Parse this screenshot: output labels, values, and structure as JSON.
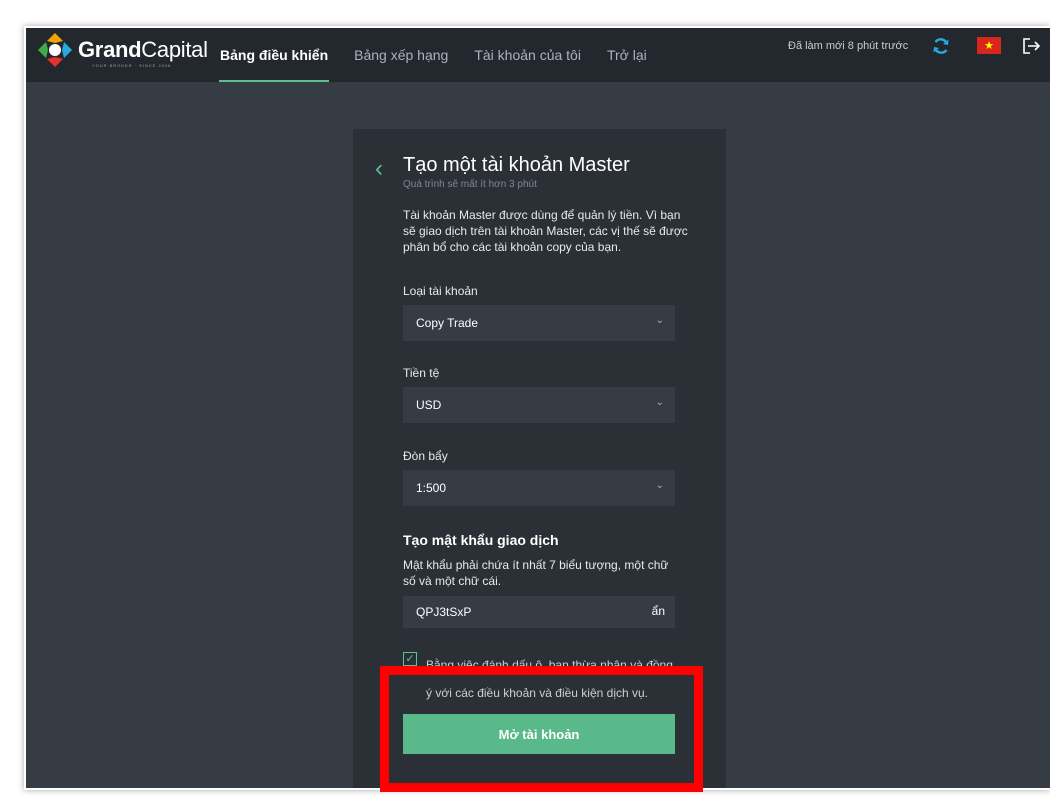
{
  "brand": {
    "name_bold": "Grand",
    "name_light": "Capital",
    "tagline": "YOUR BROKER · SINCE 2006"
  },
  "nav": {
    "items": [
      {
        "label": "Bảng điều khiển",
        "active": true
      },
      {
        "label": "Bảng xếp hạng",
        "active": false
      },
      {
        "label": "Tài khoản của tôi",
        "active": false
      },
      {
        "label": "Trở lại",
        "active": false
      }
    ]
  },
  "header": {
    "refresh_text": "Đã làm mới 8 phút trước",
    "refresh_icon": "refresh-icon",
    "flag_icon": "vietnam-flag-icon",
    "logout_icon": "logout-icon"
  },
  "form": {
    "title": "Tạo một tài khoản Master",
    "subtitle": "Quá trình sẽ mất ít hơn 3 phút",
    "description": "Tài khoản Master được dùng để quản lý tiền. Vì bạn sẽ giao dịch trên tài khoản Master, các vị thế sẽ được phân bổ cho các tài khoản copy của bạn.",
    "account_type": {
      "label": "Loại tài khoản",
      "value": "Copy Trade"
    },
    "currency": {
      "label": "Tiền tệ",
      "value": "USD"
    },
    "leverage": {
      "label": "Đòn bẩy",
      "value": "1:500"
    },
    "password": {
      "title": "Tạo mật khẩu giao dịch",
      "hint": "Mật khẩu phải chứa ít nhất 7 biểu tượng, một chữ số và một chữ cái.",
      "value": "QPJ3tSxP",
      "toggle_label": "ẩn"
    },
    "agree": {
      "checked": true,
      "text": "Bằng việc đánh dấu ô, bạn thừa nhận và đồng ý với các điều khoản và điều kiện dịch vụ."
    },
    "submit_label": "Mở tài khoản"
  },
  "colors": {
    "accent": "#5fc08e",
    "button": "#5ab98a",
    "highlight": "#ff0000",
    "topbar": "#23282e",
    "background": "#353c44",
    "panel": "#2a3036"
  }
}
